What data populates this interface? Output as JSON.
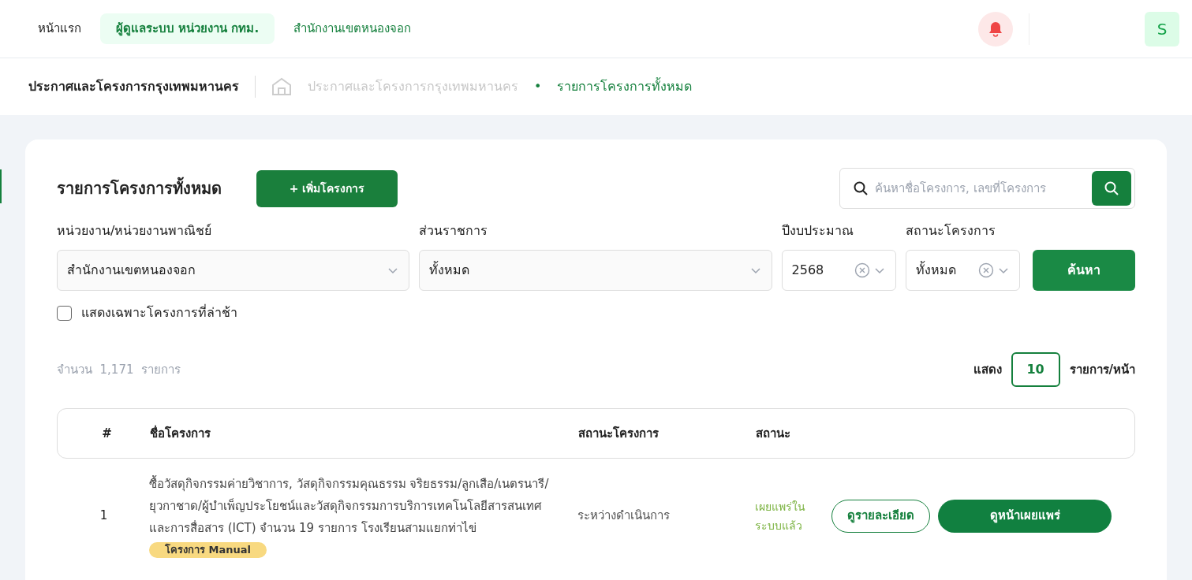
{
  "nav": {
    "items": [
      {
        "label": "หน้าแรก",
        "selected": false,
        "kind": "plain"
      },
      {
        "label": "ผู้ดูแลระบบ หน่วยงาน กทม.",
        "selected": true,
        "kind": "accent"
      },
      {
        "label": "สำนักงานเขตหนองจอก",
        "selected": false,
        "kind": "accent"
      }
    ],
    "avatar": "S"
  },
  "header": {
    "title": "ประกาศและโครงการกรุงเทพมหานคร",
    "breadcrumbs": [
      {
        "label": "ประกาศและโครงการกรุงเทพมหานคร",
        "selected": false
      },
      {
        "label": "รายการโครงการทั้งหมด",
        "selected": true
      }
    ],
    "separator": "•"
  },
  "card": {
    "title": "รายการโครงการทั้งหมด",
    "add_button": "+ เพิ่มโครงการ",
    "search": {
      "placeholder": "ค้นหาชื่อโครงการ, เลขที่โครงการ"
    },
    "filters": [
      {
        "label": "หน่วยงาน/หน่วยงานพาณิชย์",
        "value": "สำนักงานเขตหนองจอก",
        "clearable": false
      },
      {
        "label": "ส่วนราชการ",
        "value": "ทั้งหมด",
        "clearable": false
      },
      {
        "label": "ปีงบประมาณ",
        "value": "2568",
        "clearable": true
      },
      {
        "label": "สถานะโครงการ",
        "value": "ทั้งหมด",
        "clearable": true
      }
    ],
    "search_button": "ค้นหา",
    "late_only": {
      "label": "แสดงเฉพาะโครงการที่ล่าช้า",
      "checked": false
    },
    "count": {
      "prefix": "จำนวน",
      "value": "1,171",
      "suffix": "รายการ"
    },
    "page_size": {
      "prefix": "แสดง",
      "value": "10",
      "suffix": "รายการ/หน้า"
    }
  },
  "table": {
    "columns": [
      "#",
      "ชื่อโครงการ",
      "สถานะโครงการ",
      "สถานะ"
    ],
    "rows": [
      {
        "number": "1",
        "name": "ซื้อวัสดุกิจกรรมค่ายวิชาการ, วัสดุกิจกรรมคุณธรรม จริยธรรม/ลูกเสือ/เนตรนารี/ยุวกาชาด/ผู้บำเพ็ญประโยชน์และวัสดุกิจกรรมการบริการเทคโนโลยีสารสนเทศและการสื่อสาร (ICT) จำนวน 19 รายการ โรงเรียนสามแยกท่าไข่",
        "tag": "โครงการ Manual",
        "project_status": "ระหว่างดำเนินการ",
        "status": "เผยแพร่ในระบบแล้ว",
        "color": "#7cb342",
        "detail_button": "ดูรายละเอียด",
        "publish_button": "ดูหน้าเผยแพร่"
      }
    ]
  }
}
